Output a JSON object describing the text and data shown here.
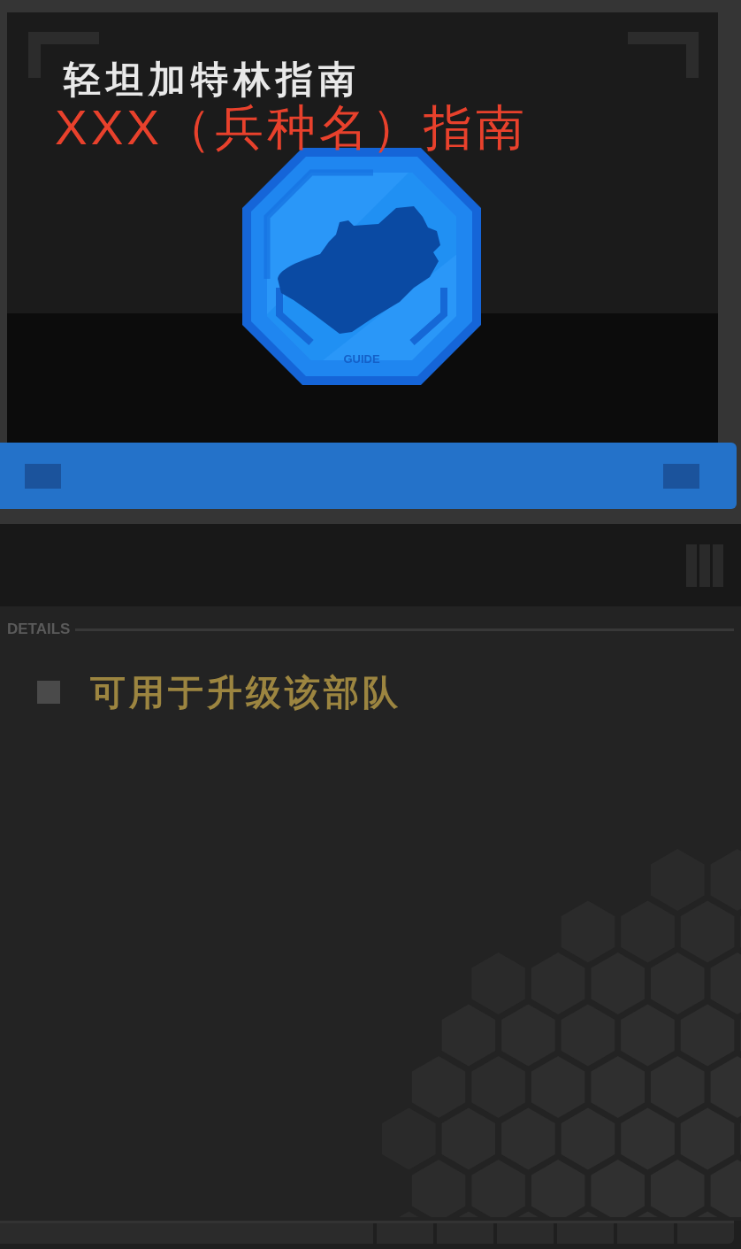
{
  "card": {
    "title": "轻坦加特林指南",
    "annotation": "XXX（兵种名）指南",
    "badge": {
      "label": "GUIDE"
    }
  },
  "details": {
    "heading": "DETAILS",
    "items": [
      {
        "text": "可用于升级该部队"
      }
    ]
  }
}
